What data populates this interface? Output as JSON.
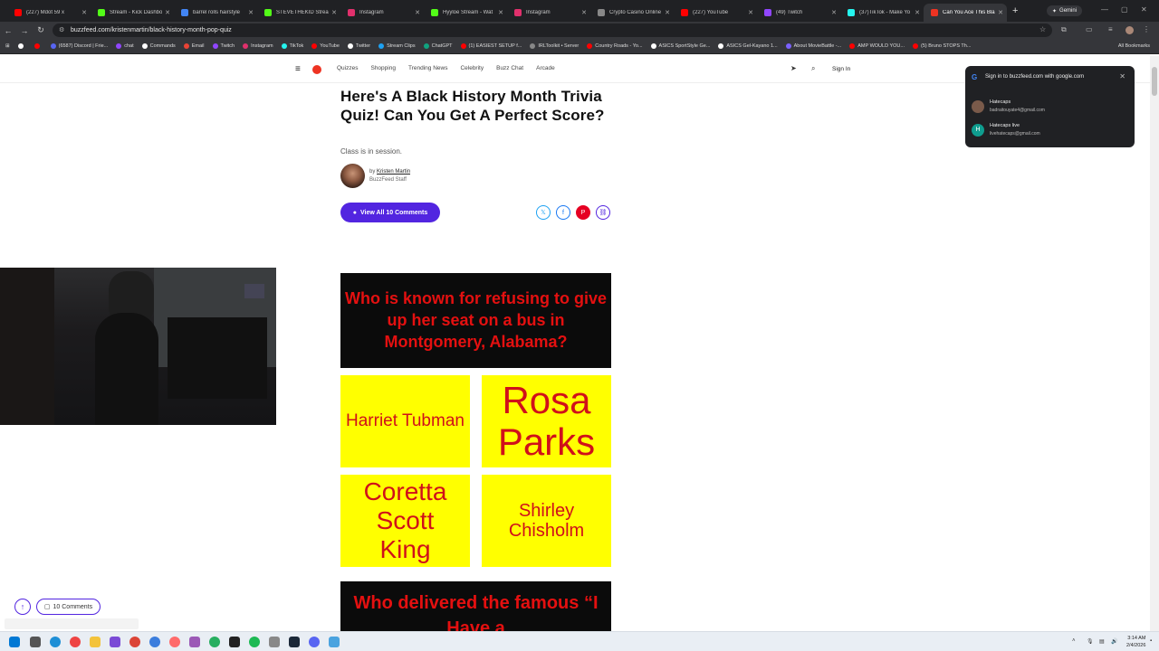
{
  "browser": {
    "tabs": [
      {
        "title": "(227) Mdot 59 x",
        "color": "#ff0000"
      },
      {
        "title": "Stream - Kick Dashbo",
        "color": "#53fc18"
      },
      {
        "title": "barrel rolls hairstyle",
        "color": "#4285f4"
      },
      {
        "title": "STEVETHEKID Strea",
        "color": "#53fc18"
      },
      {
        "title": "Instagram",
        "color": "#e1306c"
      },
      {
        "title": "Hyyloe Stream - Wat",
        "color": "#53fc18"
      },
      {
        "title": "Instagram",
        "color": "#e1306c"
      },
      {
        "title": "Crypto Casino Online",
        "color": "#888888"
      },
      {
        "title": "(227) YouTube",
        "color": "#ff0000"
      },
      {
        "title": "(49) Twitch",
        "color": "#9146ff"
      },
      {
        "title": "(37)TikTok - Make Yo",
        "color": "#25f4ee"
      },
      {
        "title": "Can You Ace This Bla",
        "color": "#e32"
      }
    ],
    "gemini_label": "Gemini",
    "url": "buzzfeed.com/kristenmartin/black-history-month-pop-quiz",
    "bookmarks": [
      {
        "label": "",
        "color": "#ffffff"
      },
      {
        "label": "",
        "color": "#ff0000"
      },
      {
        "label": "(6587) Discord | Frie...",
        "color": "#5865f2"
      },
      {
        "label": "chat",
        "color": "#9146ff"
      },
      {
        "label": "Commands",
        "color": "#ffffff"
      },
      {
        "label": "Email",
        "color": "#ea4335"
      },
      {
        "label": "Twitch",
        "color": "#9146ff"
      },
      {
        "label": "Instagram",
        "color": "#e1306c"
      },
      {
        "label": "TikTok",
        "color": "#25f4ee"
      },
      {
        "label": "YouTube",
        "color": "#ff0000"
      },
      {
        "label": "Twitter",
        "color": "#ffffff"
      },
      {
        "label": "Stream Clips",
        "color": "#1da1f2"
      },
      {
        "label": "ChatGPT",
        "color": "#10a37f"
      },
      {
        "label": "(1) EASIEST SETUP f...",
        "color": "#ff0000"
      },
      {
        "label": "IRLToolkit • Server",
        "color": "#888888"
      },
      {
        "label": "Country Roads - Yo...",
        "color": "#ff0000"
      },
      {
        "label": "ASICS SportStyle Ge...",
        "color": "#ffffff"
      },
      {
        "label": "ASICS Gel-Kayano 1...",
        "color": "#ffffff"
      },
      {
        "label": "About MovieBattle -...",
        "color": "#7b61ff"
      },
      {
        "label": "AMP WOULD YOU...",
        "color": "#ff0000"
      },
      {
        "label": "(5) Bruno STOPS Th...",
        "color": "#ff0000"
      }
    ],
    "all_bookmarks": "All Bookmarks"
  },
  "site": {
    "nav": [
      "Quizzes",
      "Shopping",
      "Trending News",
      "Celebrity",
      "Buzz Chat",
      "Arcade"
    ],
    "sign_in": "Sign In",
    "title": "Here's A Black History Month Trivia Quiz! Can You Get A Perfect Score?",
    "subtitle": "Class is in session.",
    "by": "by",
    "author": "Kristen Martin",
    "staff": "BuzzFeed Staff",
    "comments_button": "View All 10 Comments",
    "q1": "Who is known for refusing to give up her seat on a bus in Montgomery, Alabama?",
    "answers": [
      "Harriet Tubman",
      "Rosa Parks",
      "Coretta Scott King",
      "Shirley Chisholm"
    ],
    "q2": "Who delivered the famous “I Have a",
    "comments_pill": "10 Comments"
  },
  "popup": {
    "header": "Sign in to buzzfeed.com with google.com",
    "accounts": [
      {
        "name": "Hatecaps",
        "email": "badraitouyate4@gmail.com",
        "initial": ""
      },
      {
        "name": "Hatecaps live",
        "email": "livehatecaps@gmail.com",
        "initial": "H"
      }
    ]
  },
  "taskbar": {
    "time": "3:14 AM",
    "date": "2/4/2026"
  }
}
